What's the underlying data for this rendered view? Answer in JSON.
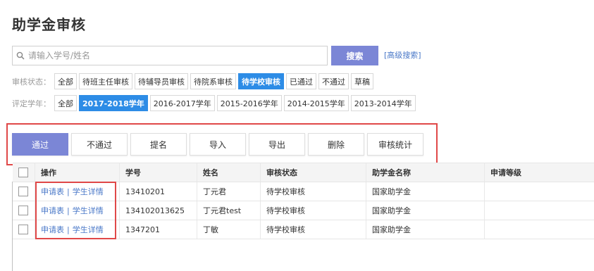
{
  "page": {
    "title": "助学金审核"
  },
  "search": {
    "placeholder": "请输入学号/姓名",
    "button": "搜索",
    "advanced": "[高级搜索]"
  },
  "filters": {
    "status": {
      "label": "审核状态：",
      "options": [
        "全部",
        "待班主任审核",
        "待辅导员审核",
        "待院系审核",
        "待学校审核",
        "已通过",
        "不通过",
        "草稿"
      ],
      "active": "待学校审核"
    },
    "year": {
      "label": "评定学年：",
      "options": [
        "全部",
        "2017-2018学年",
        "2016-2017学年",
        "2015-2016学年",
        "2014-2015学年",
        "2013-2014学年"
      ],
      "active": "2017-2018学年"
    }
  },
  "actions": [
    "通过",
    "不通过",
    "提名",
    "导入",
    "导出",
    "删除",
    "审核统计"
  ],
  "table": {
    "headers": [
      "操作",
      "学号",
      "姓名",
      "审核状态",
      "助学金名称",
      "申请等级"
    ],
    "op_links": {
      "apply": "申请表",
      "sep": "|",
      "detail": "学生详情"
    },
    "rows": [
      {
        "sno": "13410201",
        "name": "丁元君",
        "status": "待学校审核",
        "type": "国家助学金",
        "level": ""
      },
      {
        "sno": "134102013625",
        "name": "丁元君test",
        "status": "待学校审核",
        "type": "国家助学金",
        "level": ""
      },
      {
        "sno": "1347201",
        "name": "丁敏",
        "status": "待学校审核",
        "type": "国家助学金",
        "level": ""
      }
    ]
  },
  "colors": {
    "primary": "#7b86d6",
    "active_chip": "#2d8ce6",
    "highlight": "#e04848",
    "link": "#4a78c8"
  }
}
